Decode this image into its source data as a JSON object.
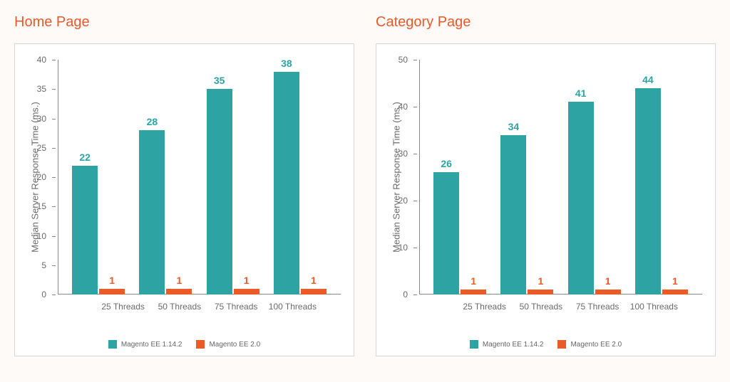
{
  "charts": [
    {
      "title": "Home Page",
      "ylabel": "Median Server Response Time (ms.)",
      "ymax": 40,
      "ystep": 5,
      "categories": [
        "25 Threads",
        "50 Threads",
        "75 Threads",
        "100 Threads"
      ],
      "series": [
        {
          "name": "Magento EE 1.14.2",
          "color": "teal",
          "values": [
            22,
            28,
            35,
            38
          ]
        },
        {
          "name": "Magento EE 2.0",
          "color": "orange",
          "values": [
            1,
            1,
            1,
            1
          ]
        }
      ]
    },
    {
      "title": "Category Page",
      "ylabel": "Median Server Response Time (ms.)",
      "ymax": 50,
      "ystep": 10,
      "categories": [
        "25 Threads",
        "50 Threads",
        "75 Threads",
        "100 Threads"
      ],
      "series": [
        {
          "name": "Magento EE 1.14.2",
          "color": "teal",
          "values": [
            26,
            34,
            41,
            44
          ]
        },
        {
          "name": "Magento EE 2.0",
          "color": "orange",
          "values": [
            1,
            1,
            1,
            1
          ]
        }
      ]
    }
  ],
  "chart_data": [
    {
      "type": "bar",
      "title": "Home Page",
      "ylabel": "Median Server Response Time (ms.)",
      "xlabel": "",
      "ylim": [
        0,
        40
      ],
      "categories": [
        "25 Threads",
        "50 Threads",
        "75 Threads",
        "100 Threads"
      ],
      "series": [
        {
          "name": "Magento EE 1.14.2",
          "values": [
            22,
            28,
            35,
            38
          ]
        },
        {
          "name": "Magento EE 2.0",
          "values": [
            1,
            1,
            1,
            1
          ]
        }
      ]
    },
    {
      "type": "bar",
      "title": "Category Page",
      "ylabel": "Median Server Response Time (ms.)",
      "xlabel": "",
      "ylim": [
        0,
        50
      ],
      "categories": [
        "25 Threads",
        "50 Threads",
        "75 Threads",
        "100 Threads"
      ],
      "series": [
        {
          "name": "Magento EE 1.14.2",
          "values": [
            26,
            34,
            41,
            44
          ]
        },
        {
          "name": "Magento EE 2.0",
          "values": [
            1,
            1,
            1,
            1
          ]
        }
      ]
    }
  ]
}
